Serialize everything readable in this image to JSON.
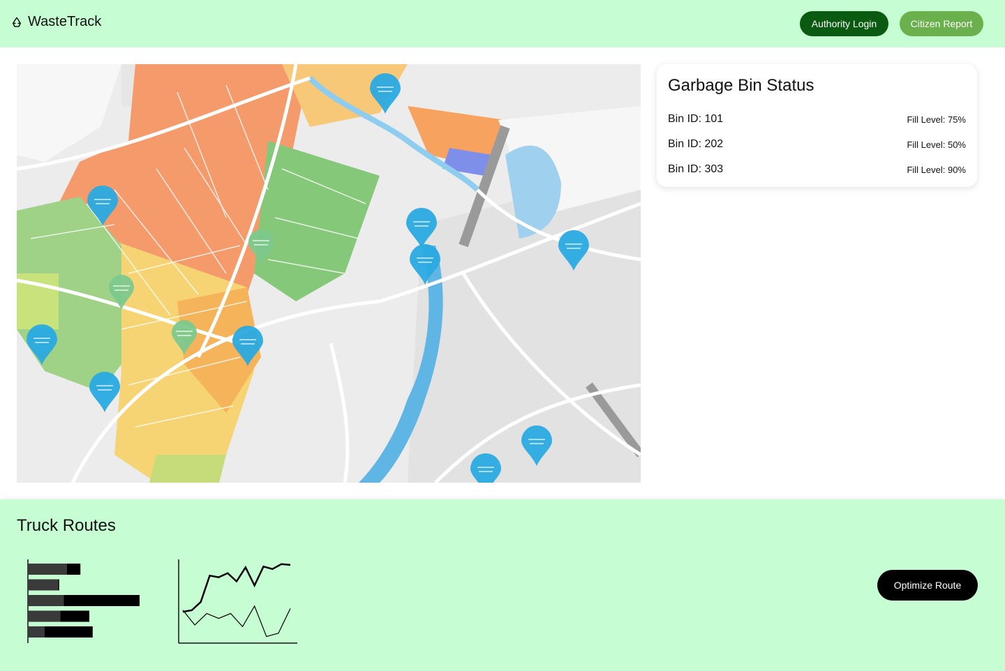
{
  "header": {
    "brand_icon": "recycle-icon",
    "brand_name": "WasteTrack",
    "login_label": "Authority Login",
    "report_label": "Citizen Report",
    "colors": {
      "bar_bg": "#c6fdd3",
      "login_bg": "#0a5a12",
      "report_bg": "#6ab04c"
    }
  },
  "map": {
    "marker_icon": "map-pin-icon",
    "marker_color": "#29aae1"
  },
  "bin_status": {
    "title": "Garbage Bin Status",
    "bins": [
      {
        "id_label": "Bin ID: 101",
        "fill_label": "Fill Level: 75%"
      },
      {
        "id_label": "Bin ID: 202",
        "fill_label": "Fill Level: 50%"
      },
      {
        "id_label": "Bin ID: 303",
        "fill_label": "Fill Level: 90%"
      }
    ]
  },
  "routes": {
    "title": "Truck Routes",
    "optimize_label": "Optimize Route"
  },
  "chart_data": [
    {
      "type": "bar",
      "orientation": "horizontal",
      "series": [
        {
          "values": [
            0.35,
            0.27,
            0.32,
            0.29,
            0.15
          ]
        },
        {
          "values": [
            0.12,
            0.01,
            0.68,
            0.26,
            0.43
          ]
        }
      ]
    },
    {
      "type": "line",
      "series": [
        {
          "values": [
            0.38,
            0.4,
            0.5,
            0.82,
            0.8,
            0.85,
            0.75,
            0.92,
            0.7,
            0.93,
            0.9,
            0.96,
            0.95
          ]
        },
        {
          "values": [
            0.4,
            0.22,
            0.36,
            0.3,
            0.36,
            0.2,
            0.45,
            0.08,
            0.12,
            0.42
          ]
        }
      ]
    }
  ]
}
